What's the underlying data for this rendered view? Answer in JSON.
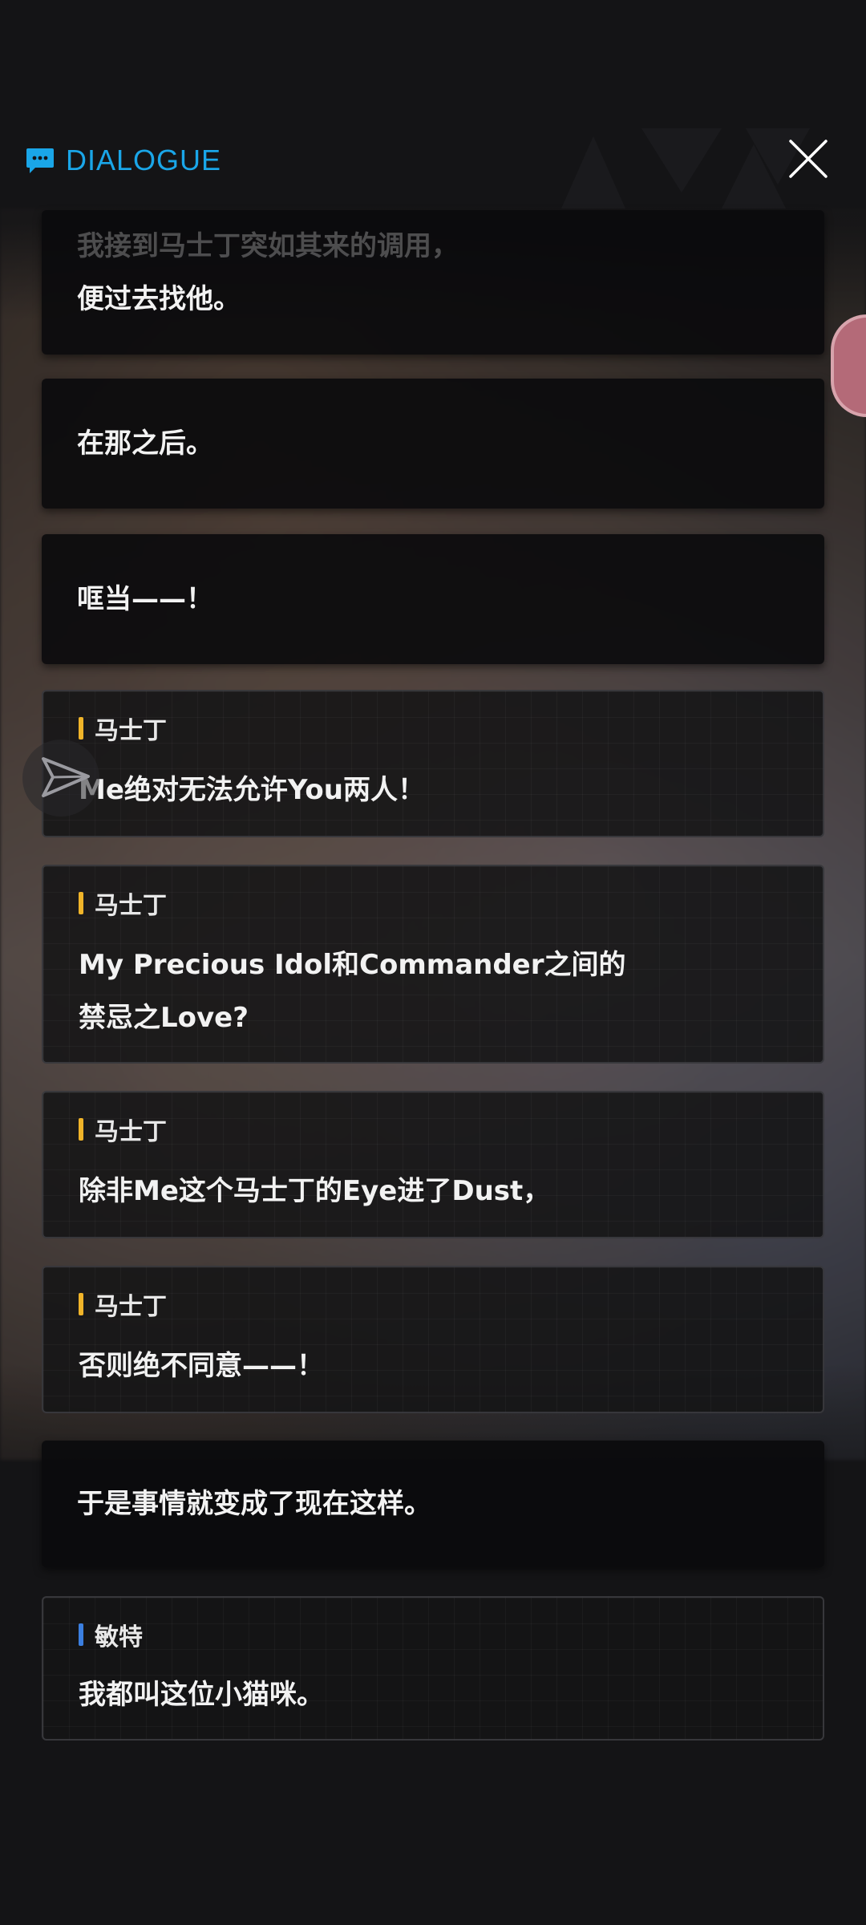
{
  "header": {
    "title": "DIALOGUE"
  },
  "colors": {
    "accent": "#1aa6e8",
    "speaker_bar_masato": "#f0b429",
    "speaker_bar_minte": "#3b7fe0"
  },
  "icons": {
    "header": "chat-bubble-icon",
    "close": "close-icon",
    "side": "send-arrow-icon"
  },
  "dialogue": [
    {
      "type": "narration",
      "lines": [
        "我接到马士丁突如其来的调用，",
        "便过去找他。"
      ]
    },
    {
      "type": "narration",
      "lines": [
        "在那之后。"
      ]
    },
    {
      "type": "narration",
      "lines": [
        "哐当——！"
      ]
    },
    {
      "type": "speech",
      "speaker": "马士丁",
      "lines": [
        "Me绝对无法允许You两人！"
      ]
    },
    {
      "type": "speech",
      "speaker": "马士丁",
      "lines": [
        "My Precious Idol和Commander之间的",
        "禁忌之Love?"
      ]
    },
    {
      "type": "speech",
      "speaker": "马士丁",
      "lines": [
        "除非Me这个马士丁的Eye进了Dust，"
      ]
    },
    {
      "type": "speech",
      "speaker": "马士丁",
      "lines": [
        "否则绝不同意——！"
      ]
    },
    {
      "type": "narration",
      "lines": [
        "于是事情就变成了现在这样。"
      ]
    },
    {
      "type": "speech",
      "speaker": "敏特",
      "lines": [
        "我都叫这位小猫咪。"
      ]
    }
  ]
}
